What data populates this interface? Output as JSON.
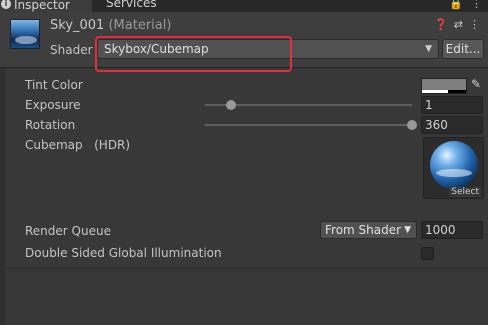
{
  "tabs": [
    {
      "label": "Inspector"
    },
    {
      "label": "Services"
    }
  ],
  "tabbar_icons": [
    "lock-icon",
    "menu-icon"
  ],
  "material": {
    "name": "Sky_001",
    "type_suffix": "(Material)",
    "header_icons": [
      "help-icon",
      "presets-icon",
      "menu-icon"
    ]
  },
  "shader": {
    "label": "Shader",
    "value": "Skybox/Cubemap",
    "edit_label": "Edit..."
  },
  "properties": {
    "tint_color": {
      "label": "Tint Color",
      "color": "#7f7f7f"
    },
    "exposure": {
      "label": "Exposure",
      "value": "1",
      "slider_fraction": 0.125
    },
    "rotation": {
      "label": "Rotation",
      "value": "360",
      "slider_fraction": 1.0
    },
    "cubemap": {
      "label": "Cubemap",
      "hdr": "(HDR)",
      "select_label": "Select"
    },
    "render_queue": {
      "label": "Render Queue",
      "mode": "From Shader",
      "value": "1000"
    },
    "double_sided_gi": {
      "label": "Double Sided Global Illumination",
      "checked": false
    }
  },
  "colors": {
    "highlight": "#e0303f",
    "tab_accent": "#3a79bb"
  }
}
